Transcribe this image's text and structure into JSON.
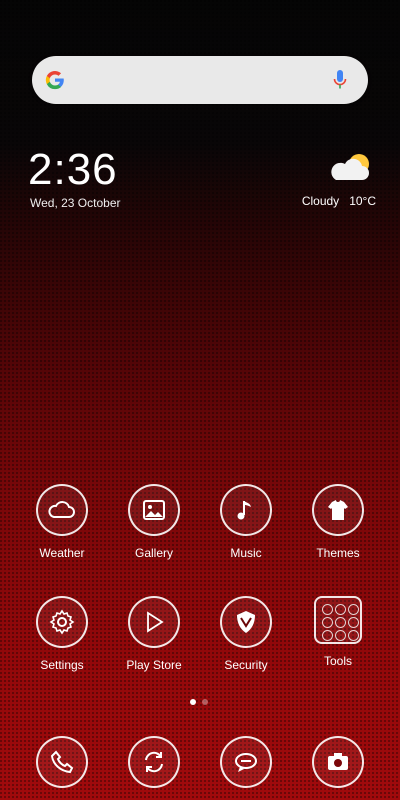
{
  "search": {
    "placeholder": "",
    "icons": [
      "google-icon",
      "mic-icon"
    ]
  },
  "clock": {
    "time": "2:36",
    "date": "Wed, 23 October"
  },
  "weather": {
    "condition": "Cloudy",
    "temp": "10°C",
    "icon": "cloudy-sun-icon"
  },
  "apps_row1": [
    {
      "label": "Weather",
      "icon": "cloud-icon"
    },
    {
      "label": "Gallery",
      "icon": "image-icon"
    },
    {
      "label": "Music",
      "icon": "music-note-icon"
    },
    {
      "label": "Themes",
      "icon": "tshirt-icon"
    }
  ],
  "apps_row2": [
    {
      "label": "Settings",
      "icon": "gear-icon"
    },
    {
      "label": "Play Store",
      "icon": "play-icon"
    },
    {
      "label": "Security",
      "icon": "shield-icon"
    },
    {
      "label": "Tools",
      "icon": "folder-grid-icon"
    }
  ],
  "dock": [
    {
      "icon": "phone-icon"
    },
    {
      "icon": "sync-icon"
    },
    {
      "icon": "message-icon"
    },
    {
      "icon": "camera-icon"
    }
  ],
  "page_indicator": {
    "pages": 2,
    "current": 1
  },
  "colors": {
    "bg_top": "#050505",
    "bg_bottom": "#a10a0c",
    "search_bg": "#e9e9e9"
  }
}
